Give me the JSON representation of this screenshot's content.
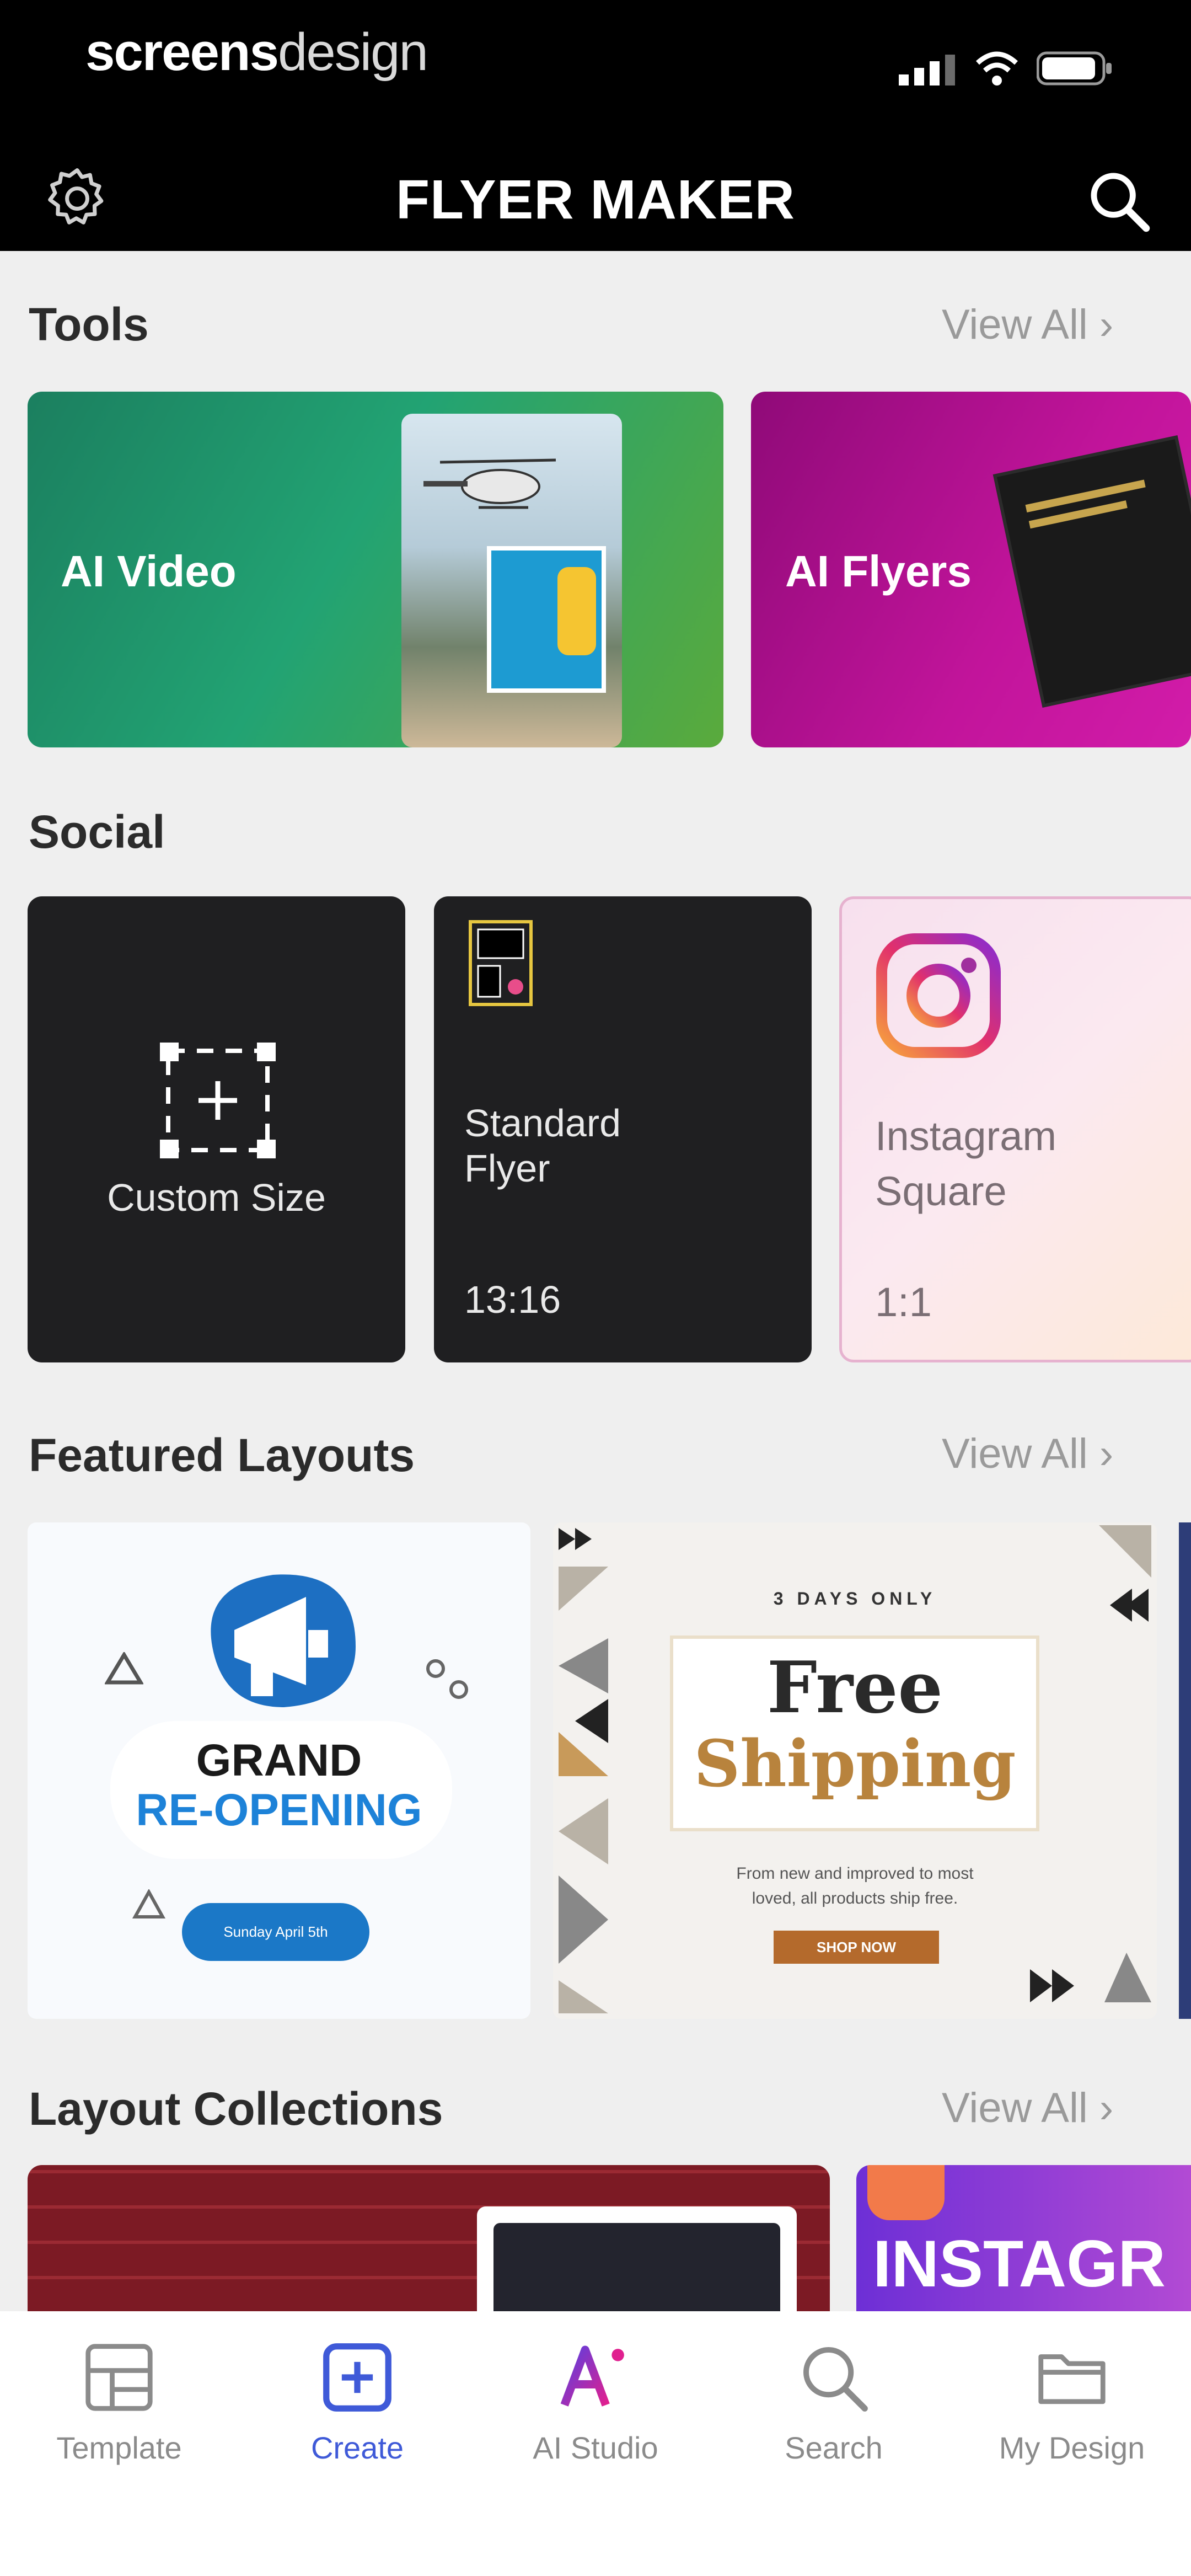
{
  "status_bar": {
    "brand_bold": "screens",
    "brand_light": "design"
  },
  "nav": {
    "title": "FLYER MAKER"
  },
  "tools": {
    "title": "Tools",
    "view_all": "View All",
    "items": [
      {
        "label": "AI Video"
      },
      {
        "label": "AI Flyers"
      }
    ]
  },
  "social": {
    "title": "Social",
    "items": [
      {
        "label": "Custom Size"
      },
      {
        "label_line1": "Standard",
        "label_line2": "Flyer",
        "ratio": "13:16"
      },
      {
        "label_line1": "Instagram",
        "label_line2": "Square",
        "ratio": "1:1"
      }
    ]
  },
  "featured": {
    "title": "Featured Layouts",
    "view_all": "View All",
    "card1": {
      "line1": "GRAND",
      "line2": "RE-OPENING",
      "pill": "Sunday April 5th"
    },
    "card2": {
      "kicker": "3 DAYS ONLY",
      "line1": "Free",
      "line2": "Shipping",
      "body1": "From new and improved to most",
      "body2": "loved, all products ship free.",
      "button": "SHOP NOW"
    }
  },
  "collections": {
    "title": "Layout Collections",
    "view_all": "View All",
    "card2_text": "INSTAGR"
  },
  "tabs": [
    {
      "label": "Template"
    },
    {
      "label": "Create"
    },
    {
      "label": "AI Studio"
    },
    {
      "label": "Search"
    },
    {
      "label": "My Design"
    }
  ],
  "colors": {
    "accent": "#3f5ad8",
    "ai_video_gradient": [
      "#1e8f63",
      "#5aaa3c"
    ],
    "ai_flyers_gradient": [
      "#9a0a7d",
      "#d11aa6"
    ]
  }
}
